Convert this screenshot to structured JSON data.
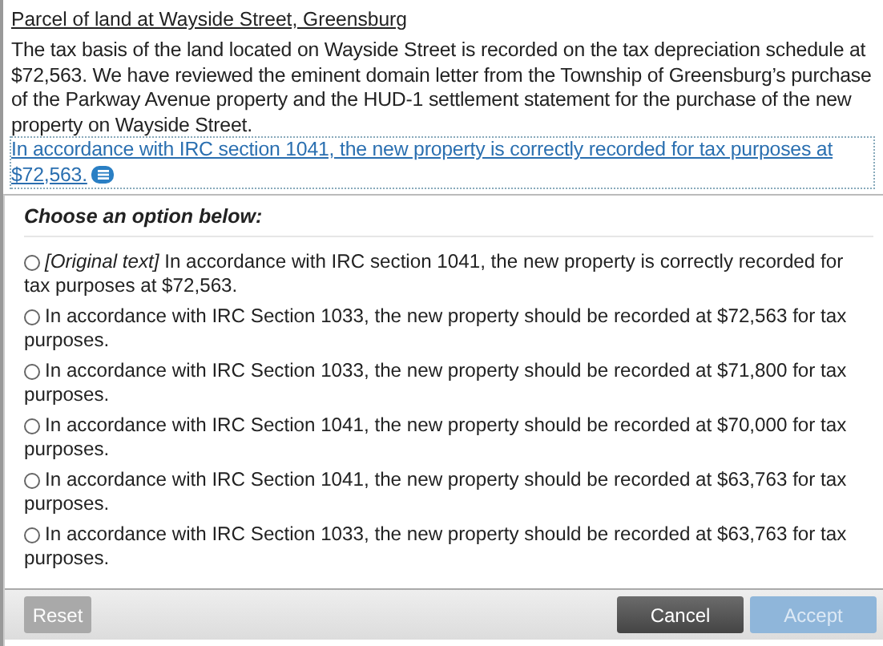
{
  "heading": "Parcel of land at Wayside Street, Greensburg",
  "paragraph": "The tax basis of the land located on Wayside Street is recorded on the tax depreciation schedule at $72,563. We have reviewed the eminent domain letter from the Township of Greensburg’s purchase of the Parkway Avenue property and the HUD-1 settlement statement for the purchase of the new property on Wayside Street.",
  "highlighted_text": "In accordance with IRC section 1041, the new property is correctly recorded for tax purposes at $72,563.",
  "prompt": "Choose an option below:",
  "options": [
    {
      "text": "*[Original text]* In accordance with IRC section 1041, the new property is correctly recorded for tax purposes at $72,563.",
      "selected": false
    },
    {
      "text": "In accordance with IRC Section 1033, the new property should be recorded at $72,563 for tax purposes.",
      "selected": false
    },
    {
      "text": "In accordance with IRC Section 1033, the new property should be recorded at $71,800 for tax purposes.",
      "selected": false
    },
    {
      "text": "In accordance with IRC Section 1041, the new property should be recorded at $70,000 for tax purposes.",
      "selected": false
    },
    {
      "text": "In accordance with IRC Section 1041, the new property should be recorded at $63,763 for tax purposes.",
      "selected": false
    },
    {
      "text": "In accordance with IRC Section 1033, the new property should be recorded at $63,763 for tax purposes.",
      "selected": false
    }
  ],
  "buttons": [
    {
      "label": "Reset",
      "kind": "reset",
      "disabled": true
    },
    {
      "label": "Cancel",
      "kind": "cancel",
      "disabled": false
    },
    {
      "label": "Accept",
      "kind": "accept",
      "disabled": true
    }
  ]
}
